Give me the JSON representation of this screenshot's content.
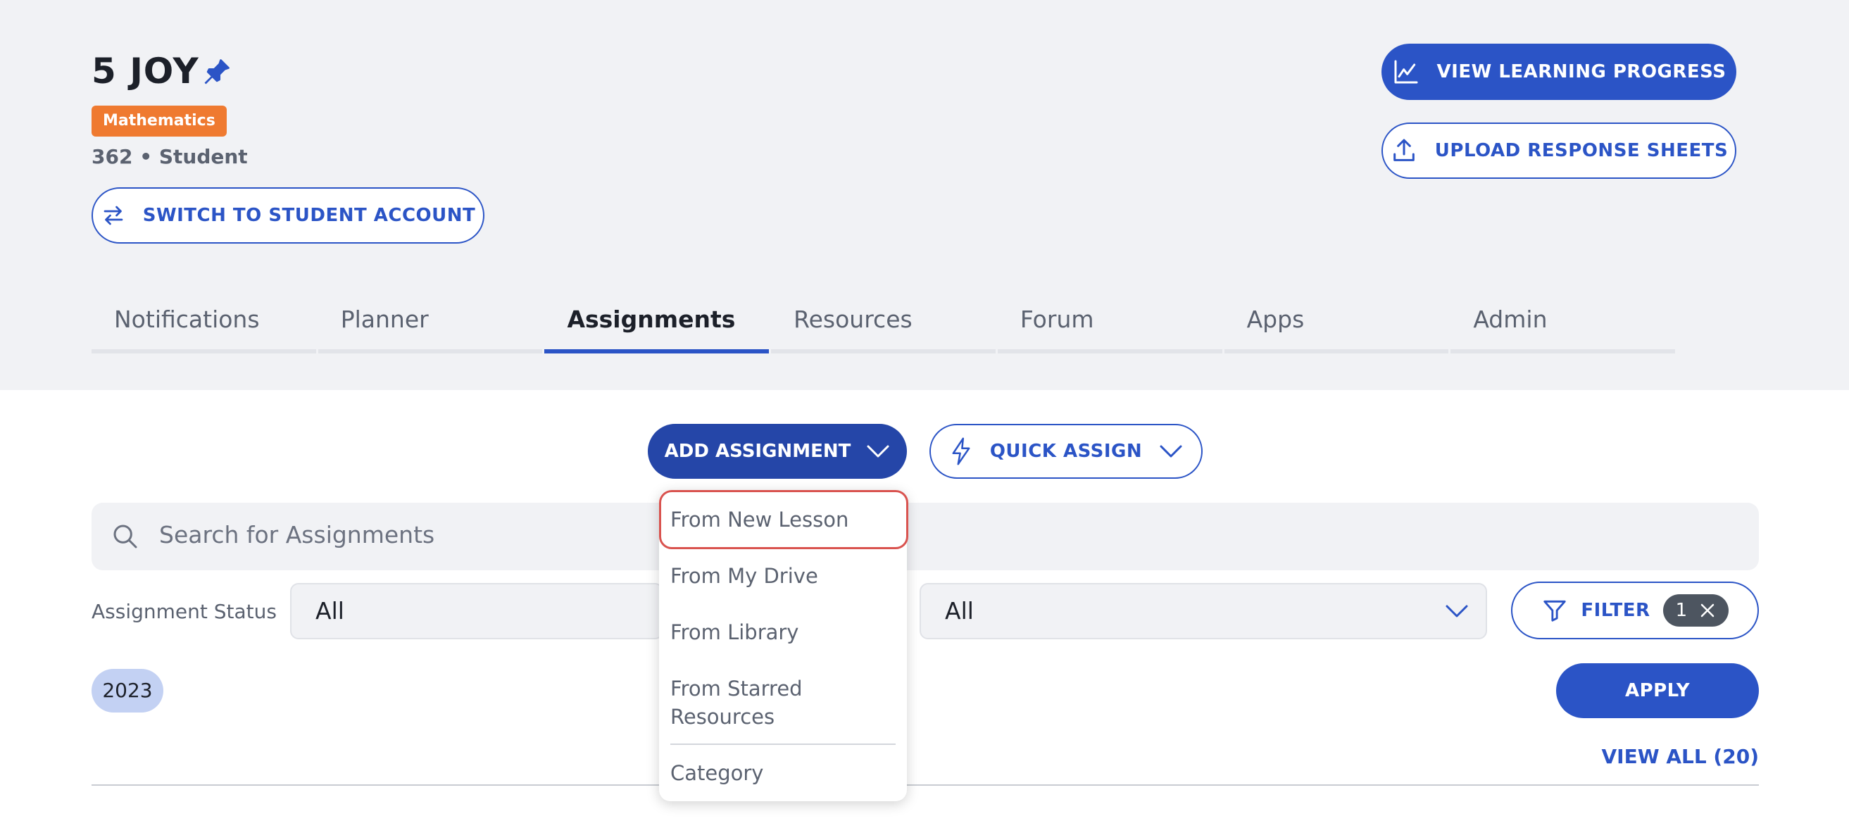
{
  "header": {
    "class_title": "5 JOY",
    "subject": "Mathematics",
    "meta": "362 • Student",
    "switch_account_label": "SWITCH TO STUDENT ACCOUNT",
    "view_progress_label": "VIEW LEARNING PROGRESS",
    "upload_sheets_label": "UPLOAD RESPONSE SHEETS"
  },
  "tabs": [
    {
      "label": "Notifications",
      "active": false
    },
    {
      "label": "Planner",
      "active": false
    },
    {
      "label": "Assignments",
      "active": true
    },
    {
      "label": "Resources",
      "active": false
    },
    {
      "label": "Forum",
      "active": false
    },
    {
      "label": "Apps",
      "active": false
    },
    {
      "label": "Admin",
      "active": false
    }
  ],
  "toolbar": {
    "add_assignment_label": "ADD ASSIGNMENT",
    "quick_assign_label": "QUICK ASSIGN"
  },
  "search": {
    "placeholder": "Search for Assignments"
  },
  "filters": {
    "status_label": "Assignment Status",
    "status_value": "All",
    "second_value": "All",
    "filter_label": "FILTER",
    "filter_count": "1",
    "year_chip": "2023",
    "apply_label": "APPLY",
    "view_all_label": "VIEW ALL (20)"
  },
  "dropdown": {
    "items": [
      {
        "label": "From New Lesson",
        "highlighted": true
      },
      {
        "label": "From My Drive"
      },
      {
        "label": "From Library"
      },
      {
        "label": "From Starred Resources"
      },
      {
        "label": "Category"
      }
    ]
  },
  "colors": {
    "primary": "#2b54c6",
    "primary_dark": "#2546a8",
    "badge_orange": "#ef7a30",
    "header_bg": "#f1f2f5",
    "highlight_red": "#d9534f"
  }
}
